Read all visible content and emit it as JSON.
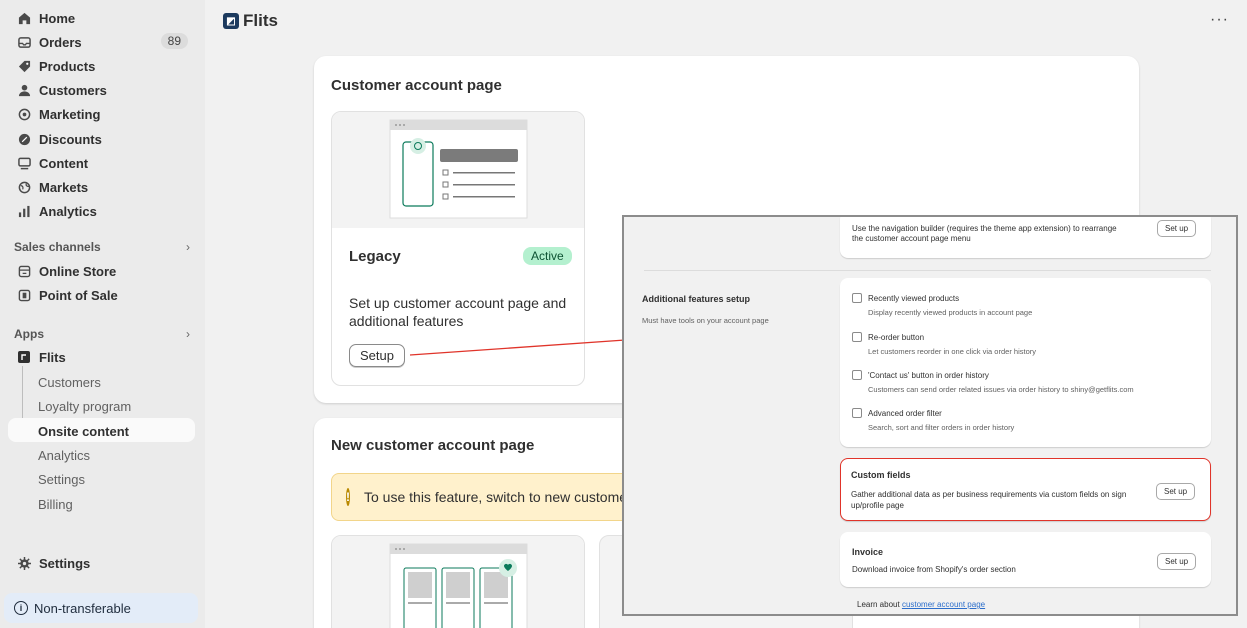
{
  "sidebar": {
    "items": [
      {
        "label": "Home",
        "icon": "home-icon"
      },
      {
        "label": "Orders",
        "icon": "orders-icon",
        "badge": "89"
      },
      {
        "label": "Products",
        "icon": "tag-icon"
      },
      {
        "label": "Customers",
        "icon": "person-icon"
      },
      {
        "label": "Marketing",
        "icon": "target-icon"
      },
      {
        "label": "Discounts",
        "icon": "discount-icon"
      },
      {
        "label": "Content",
        "icon": "content-icon"
      },
      {
        "label": "Markets",
        "icon": "globe-icon"
      },
      {
        "label": "Analytics",
        "icon": "bar-chart-icon"
      }
    ],
    "sales_channels_label": "Sales channels",
    "sales_channels": [
      {
        "label": "Online Store",
        "icon": "store-icon"
      },
      {
        "label": "Point of Sale",
        "icon": "pos-icon"
      }
    ],
    "apps_label": "Apps",
    "app_name": "Flits",
    "app_sub_items": [
      "Customers",
      "Loyalty program",
      "Onsite content",
      "Analytics",
      "Settings",
      "Billing"
    ],
    "settings_label": "Settings",
    "non_transferable_label": "Non-transferable"
  },
  "topbar": {
    "title": "Flits",
    "more": "···"
  },
  "customer_account_card": {
    "title": "Customer account page",
    "legacy_title": "Legacy",
    "active_badge": "Active",
    "description": "Set up customer account page and additional features",
    "setup_button": "Setup"
  },
  "new_account_card": {
    "title": "New customer account page",
    "warning": "To use this feature, switch to new customer"
  },
  "overlay": {
    "nav_builder_desc": "Use the navigation builder (requires the theme app extension) to rearrange the customer account page menu",
    "nav_builder_button": "Set up",
    "additional_title": "Additional features setup",
    "additional_desc": "Must have tools on your account page",
    "features": [
      {
        "label": "Recently viewed products",
        "desc": "Display recently viewed products in account page"
      },
      {
        "label": "Re-order button",
        "desc": "Let customers reorder in one click via order history"
      },
      {
        "label": "'Contact us' button in order history",
        "desc": "Customers can send order related issues via order history to shiny@getflits.com"
      },
      {
        "label": "Advanced order filter",
        "desc": "Search, sort and filter orders in order history"
      }
    ],
    "custom_fields_title": "Custom fields",
    "custom_fields_desc": "Gather additional data as per business requirements via custom fields on sign up/profile page",
    "custom_fields_button": "Set up",
    "invoice_title": "Invoice",
    "invoice_desc": "Download invoice from Shopify's order section",
    "invoice_button": "Set up",
    "learn_prefix": "Learn about ",
    "learn_link": "customer account page"
  },
  "colors": {
    "annotation_red": "#e0342a",
    "active_green": "#b4f0cf",
    "warning_bg": "#fff1cc",
    "accent_teal": "#0b7a5b"
  }
}
